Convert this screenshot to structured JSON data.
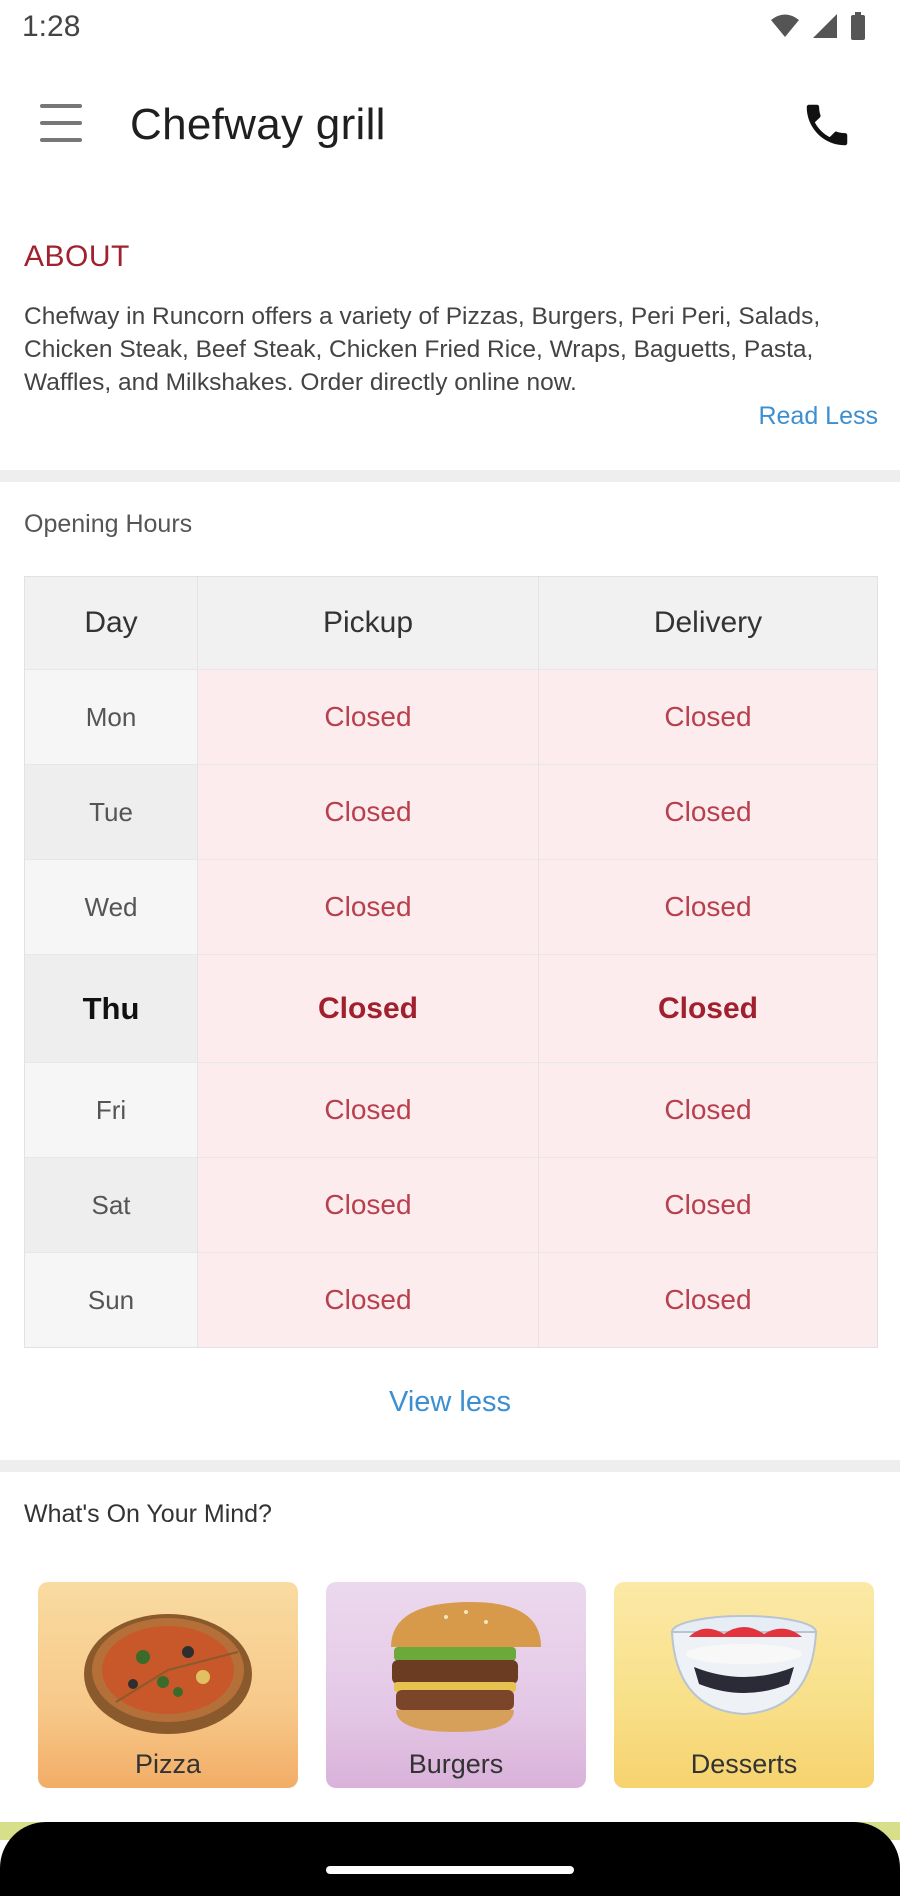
{
  "status_bar": {
    "time": "1:28",
    "icons": [
      "wifi-icon",
      "signal-icon",
      "battery-icon"
    ]
  },
  "app_bar": {
    "title": "Chefway grill",
    "menu_icon": "hamburger-menu-icon",
    "phone_icon": "phone-icon"
  },
  "about": {
    "heading": "ABOUT",
    "text": "Chefway in Runcorn offers a variety of Pizzas, Burgers, Peri Peri, Salads, Chicken Steak, Beef Steak, Chicken Fried Rice, Wraps, Baguetts, Pasta, Waffles, and Milkshakes. Order directly online now.",
    "read_less": "Read Less"
  },
  "opening_hours": {
    "title": "Opening Hours",
    "headers": {
      "day": "Day",
      "pickup": "Pickup",
      "delivery": "Delivery"
    },
    "rows": [
      {
        "day": "Mon",
        "pickup": "Closed",
        "delivery": "Closed"
      },
      {
        "day": "Tue",
        "pickup": "Closed",
        "delivery": "Closed"
      },
      {
        "day": "Wed",
        "pickup": "Closed",
        "delivery": "Closed"
      },
      {
        "day": "Thu",
        "pickup": "Closed",
        "delivery": "Closed"
      },
      {
        "day": "Fri",
        "pickup": "Closed",
        "delivery": "Closed"
      },
      {
        "day": "Sat",
        "pickup": "Closed",
        "delivery": "Closed"
      },
      {
        "day": "Sun",
        "pickup": "Closed",
        "delivery": "Closed"
      }
    ],
    "highlighted_day": "Thu",
    "view_less": "View less"
  },
  "whats_on_your_mind": {
    "title": "What's On Your Mind?",
    "categories": [
      {
        "label": "Pizza",
        "icon": "pizza-icon"
      },
      {
        "label": "Burgers",
        "icon": "burger-icon"
      },
      {
        "label": "Desserts",
        "icon": "dessert-icon"
      }
    ]
  },
  "colors": {
    "accent_red": "#a0222f",
    "link_blue": "#3c8fd0",
    "closed_bg": "#fcecee"
  }
}
